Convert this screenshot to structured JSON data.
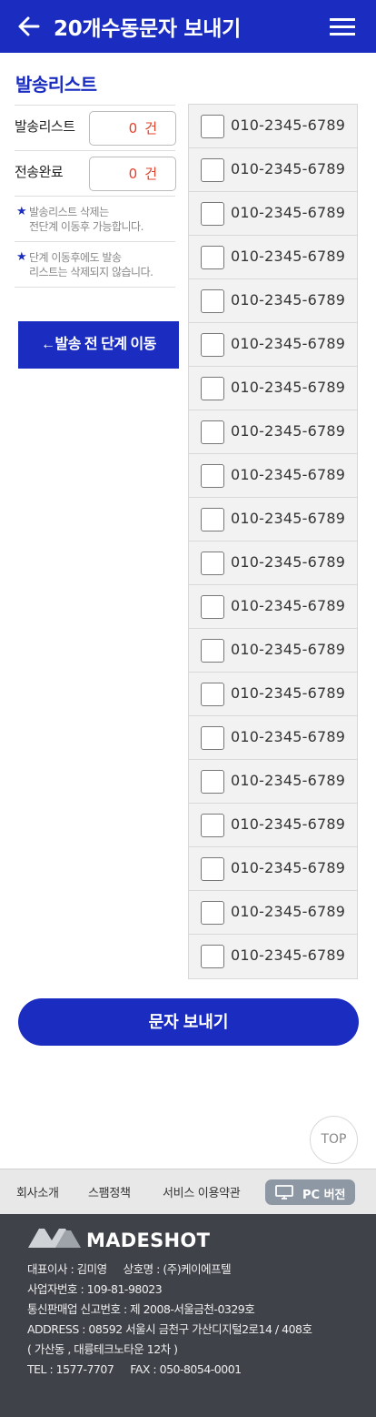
{
  "header": {
    "title": "20개수동문자 보내기"
  },
  "section_title": "발송리스트",
  "stats": [
    {
      "label": "발송리스트",
      "value": "0",
      "unit": "건"
    },
    {
      "label": "전송완료",
      "value": "0",
      "unit": "건"
    }
  ],
  "notes": [
    {
      "line1": "발송리스트 삭제는",
      "line2": "전단계 이동후 가능합니다."
    },
    {
      "line1": "단계 이동후에도 발송",
      "line2": "리스트는 삭제되지 않습니다."
    }
  ],
  "prev_step_label": "←발송 전 단계 이동",
  "recipients": [
    {
      "phone": "010-2345-6789"
    },
    {
      "phone": "010-2345-6789"
    },
    {
      "phone": "010-2345-6789"
    },
    {
      "phone": "010-2345-6789"
    },
    {
      "phone": "010-2345-6789"
    },
    {
      "phone": "010-2345-6789"
    },
    {
      "phone": "010-2345-6789"
    },
    {
      "phone": "010-2345-6789"
    },
    {
      "phone": "010-2345-6789"
    },
    {
      "phone": "010-2345-6789"
    },
    {
      "phone": "010-2345-6789"
    },
    {
      "phone": "010-2345-6789"
    },
    {
      "phone": "010-2345-6789"
    },
    {
      "phone": "010-2345-6789"
    },
    {
      "phone": "010-2345-6789"
    },
    {
      "phone": "010-2345-6789"
    },
    {
      "phone": "010-2345-6789"
    },
    {
      "phone": "010-2345-6789"
    },
    {
      "phone": "010-2345-6789"
    },
    {
      "phone": "010-2345-6789"
    }
  ],
  "send_label": "문자 보내기",
  "top_label": "TOP",
  "footer_nav": {
    "company": "회사소개",
    "spam": "스팸정책",
    "terms": "서비스 이용약관",
    "pc": "PC 버전"
  },
  "footer": {
    "logo": "MADESHOT",
    "ceo": "대표이사 : 김미영",
    "company": "상호명 : (주)케이에프텔",
    "biz_no": "사업자번호 : 109-81-98023",
    "mail_order": "통신판매업 신고번호 : 제 2008-서울금천-0329호",
    "address": "ADDRESS : 08592 서울시 금천구 가산디지털2로14 / 408호",
    "address2": "( 가산동 , 대륭테크노타운 12차 )",
    "tel": "TEL : 1577-7707",
    "fax": "FAX : 050-8054-0001"
  },
  "colors": {
    "brand": "#1b2dc0",
    "count": "#e4412b",
    "footer_bg": "#3f4249"
  },
  "icons": [
    "back-arrow-icon",
    "hamburger-menu-icon",
    "monitor-icon",
    "madeshot-logo"
  ]
}
